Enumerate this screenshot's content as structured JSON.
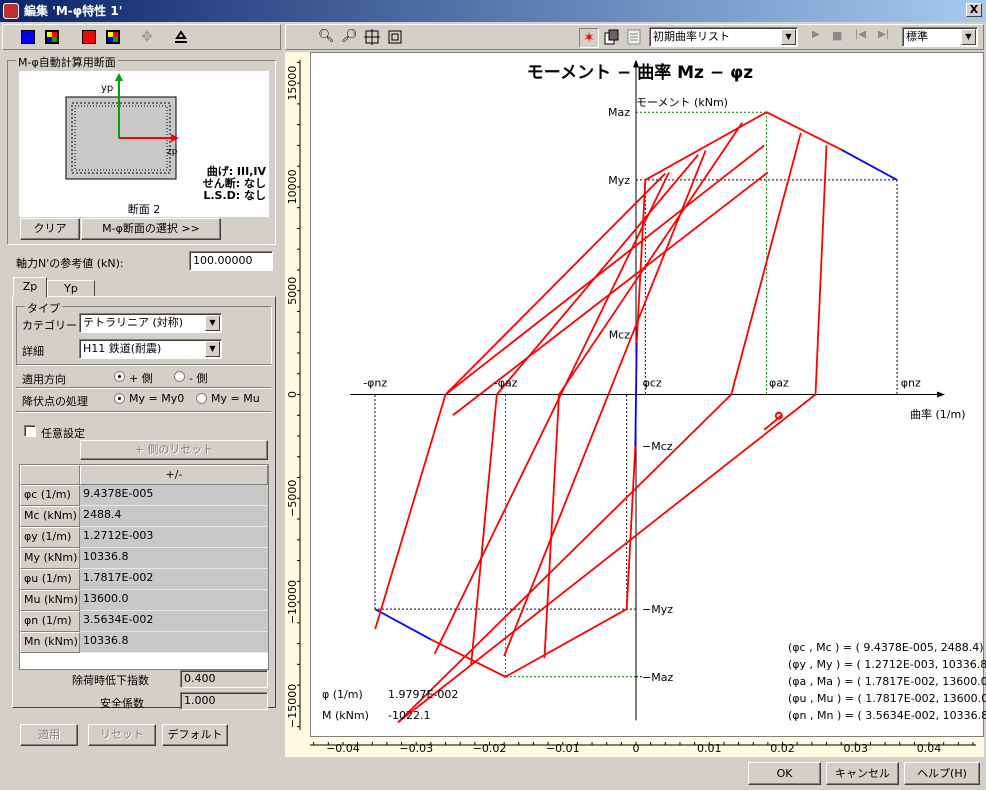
{
  "window": {
    "title": "編集 'M-φ特性 1'",
    "close": "X"
  },
  "left_toolbar": {
    "icons": [
      "color-blue-icon",
      "pattern-multicolor-icon",
      "color-red-icon",
      "pattern-multicolor-icon",
      "move-icon",
      "section-icon"
    ],
    "colors": {
      "blue": "#0000ff",
      "red": "#ff0000"
    }
  },
  "section_panel": {
    "group_title": "M-φ自動計算用断面",
    "axis_y": "yp",
    "axis_z": "zp",
    "info_line1": "曲げ: III,IV",
    "info_line2": "せん断: なし",
    "info_line3": "L.S.D: なし",
    "section_name": "断面 2",
    "clear_button": "クリア",
    "select_button": "M-φ断面の選択 >>"
  },
  "axial": {
    "label": "軸力N'の参考値 (kN):",
    "value": "100.00000"
  },
  "tabs": [
    "Zp",
    "Yp"
  ],
  "type_group": {
    "title": "タイプ",
    "category_label": "カテゴリー",
    "category_value": "テトラリニア (対称)",
    "detail_label": "詳細",
    "detail_value": "H11 鉄道(耐震)"
  },
  "direction": {
    "label": "適用方向",
    "opt_plus": "+ 側",
    "opt_minus": "- 側"
  },
  "yield": {
    "label": "降伏点の処理",
    "opt1": "My = My0",
    "opt2": "My = Mu"
  },
  "arbitrary": {
    "label": "任意設定",
    "reset_plus_button": "+ 側のリセット"
  },
  "param_table": {
    "header": "+/-",
    "rows": [
      {
        "name": "φc (1/m)",
        "value": "9.4378E-005"
      },
      {
        "name": "Mc (kNm)",
        "value": "2488.4"
      },
      {
        "name": "φy (1/m)",
        "value": "1.2712E-003"
      },
      {
        "name": "My (kNm)",
        "value": "10336.8"
      },
      {
        "name": "φu (1/m)",
        "value": "1.7817E-002"
      },
      {
        "name": "Mu (kNm)",
        "value": "13600.0"
      },
      {
        "name": "φn (1/m)",
        "value": "3.5634E-002"
      },
      {
        "name": "Mn (kNm)",
        "value": "10336.8"
      }
    ]
  },
  "unloading": {
    "label": "除荷時低下指数",
    "value": "0.400"
  },
  "safety": {
    "label": "安全係数",
    "value": "1.000"
  },
  "bottom_left_buttons": {
    "apply": "適用",
    "reset": "リセット",
    "default": "デフォルト"
  },
  "chart_toolbar": {
    "icons": [
      "zoom-in-icon",
      "zoom-out-icon",
      "zoom-window-icon",
      "zoom-fit-icon",
      "run-icon",
      "copy-icon",
      "list-icon",
      "play-icon",
      "stop-icon",
      "step-back-icon",
      "step-forward-icon"
    ],
    "list_combo": "初期曲率リスト",
    "mode_combo": "標準"
  },
  "dialog_buttons": {
    "ok": "OK",
    "cancel": "キャンセル",
    "help": "ヘルプ(H)"
  },
  "readout": {
    "phi_label": "φ (1/m)",
    "phi_value": "1.9797E-002",
    "m_label": "M (kNm)",
    "m_value": "-1022.1"
  },
  "legend_lines": [
    "(φc , Mc ) = ( 9.4378E-005,   2488.4)",
    "(φy , My ) = ( 1.2712E-003, 10336.8)",
    "(φa , Ma ) = ( 1.7817E-002, 13600.0)",
    "(φu , Mu ) = ( 1.7817E-002, 13600.0)",
    "(φn , Mn ) = ( 3.5634E-002, 10336.8)"
  ],
  "chart_data": {
    "type": "line",
    "title": "モーメント − 曲率 Mz − φz",
    "xlabel": "曲率 (1/m)",
    "ylabel": "モーメント (kNm)",
    "xlim": [
      -0.0445,
      0.0475
    ],
    "ylim": [
      -16500,
      16500
    ],
    "xticks": [
      -0.04,
      -0.03,
      -0.02,
      -0.01,
      0,
      0.01,
      0.02,
      0.03,
      0.04
    ],
    "xtick_labels": [
      "−0.04",
      "−0.03",
      "−0.02",
      "−0.01",
      "0",
      "0.01",
      "0.02",
      "0.03",
      "0.04"
    ],
    "yticks": [
      -15000,
      -10000,
      -5000,
      0,
      5000,
      10000,
      15000
    ],
    "ytick_labels": [
      "−15000",
      "−10000",
      "−5000",
      "0",
      "5000",
      "10000",
      "15000"
    ],
    "point_labels": {
      "phi_nz_neg": "-φnz",
      "phi_az_neg": "-φaz",
      "phi_cz": "φcz",
      "phi_az": "φaz",
      "phi_nz": "φnz",
      "M_az": "Maz",
      "M_yz": "Myz",
      "M_cz": "Mcz",
      "M_cz_neg": "−Mcz",
      "M_yz_neg": "−Myz",
      "M_az_neg": "−Maz"
    },
    "key_points": {
      "phi_c": 9.44e-05,
      "M_c": 2488.4,
      "phi_y": 0.0012712,
      "M_y": 10336.8,
      "phi_a": 0.017817,
      "M_a": 13600.0,
      "phi_n": 0.035634,
      "M_n": 10336.8
    },
    "series": [
      {
        "color": "#0000ff",
        "segments": [
          [
            [
              -9.4e-05,
              -2488.4
            ],
            [
              9.4e-05,
              2488.4
            ]
          ],
          [
            [
              0.028,
              11800
            ],
            [
              0.035634,
              10336.8
            ]
          ],
          [
            [
              -0.035634,
              -10336.8
            ],
            [
              -0.028,
              -11800
            ]
          ]
        ]
      },
      {
        "color": "#ff0000",
        "segments": [
          [
            [
              9.4e-05,
              2488.4
            ],
            [
              0.0012712,
              10336.8
            ],
            [
              0.017817,
              13600
            ],
            [
              0.028,
              11800
            ]
          ],
          [
            [
              -9.4e-05,
              -2488.4
            ],
            [
              -0.0012712,
              -10336.8
            ],
            [
              -0.017817,
              -13600
            ],
            [
              -0.028,
              -11800
            ]
          ],
          [
            [
              0.004,
              10650
            ],
            [
              -0.026,
              0
            ],
            [
              -0.0356,
              -11300
            ]
          ],
          [
            [
              0.0085,
              11550
            ],
            [
              -0.019,
              0
            ],
            [
              -0.0225,
              -13000
            ]
          ],
          [
            [
              0.0145,
              13100
            ],
            [
              -0.0105,
              0
            ],
            [
              -0.0125,
              -12700
            ]
          ],
          [
            [
              0.0225,
              12600
            ],
            [
              0.013,
              0
            ],
            [
              -0.0325,
              -15800
            ]
          ],
          [
            [
              0.026,
              12000
            ],
            [
              0.0245,
              0
            ],
            [
              -0.0325,
              -15800
            ]
          ],
          [
            [
              0.0095,
              11750
            ],
            [
              -0.018,
              -12600
            ]
          ],
          [
            [
              0.0045,
              10700
            ],
            [
              -0.0275,
              -12500
            ]
          ],
          [
            [
              -0.025,
              -1000
            ],
            [
              0.018,
              10700
            ]
          ],
          [
            [
              -0.026,
              0
            ],
            [
              0.0175,
              12000
            ]
          ],
          [
            [
              0.0198,
              -1022
            ],
            [
              0.0175,
              -1700
            ]
          ]
        ]
      }
    ]
  }
}
